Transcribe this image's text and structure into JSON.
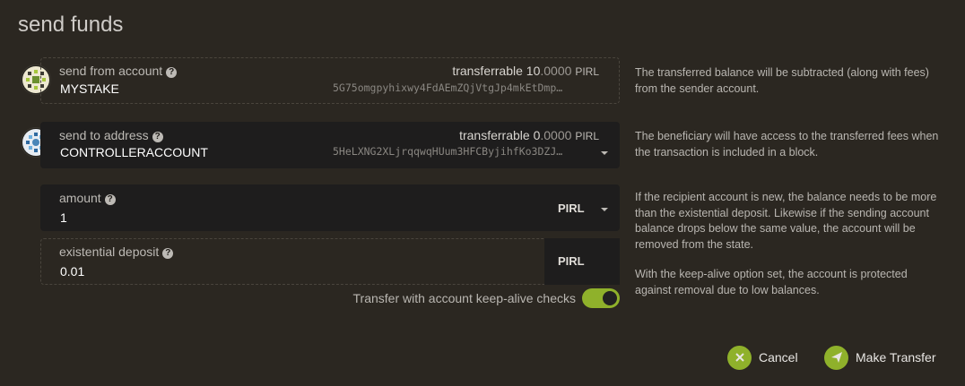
{
  "title": "send funds",
  "send_from": {
    "label": "send from account",
    "name": "MYSTAKE",
    "balance_label": "transferrable",
    "balance_int": "10",
    "balance_dec": ".0000",
    "balance_unit": "PIRL",
    "address": "5G75omgpyhixwy4FdAEmZQjVtgJp4mkEtDmp…",
    "help": "The transferred balance will be subtracted (along with fees) from the sender account."
  },
  "send_to": {
    "label": "send to address",
    "name": "CONTROLLERACCOUNT",
    "balance_label": "transferrable",
    "balance_int": "0",
    "balance_dec": ".0000",
    "balance_unit": "PIRL",
    "address": "5HeLXNG2XLjrqqwqHUum3HFCByjihfKo3DZJ…",
    "help": "The beneficiary will have access to the transferred fees when the transaction is included in a block."
  },
  "amount": {
    "label": "amount",
    "value": "1",
    "unit": "PIRL",
    "help": "If the recipient account is new, the balance needs to be more than the existential deposit. Likewise if the sending account balance drops below the same value, the account will be removed from the state."
  },
  "existential": {
    "label": "existential deposit",
    "value": "0.01",
    "unit": "PIRL"
  },
  "keepalive": {
    "label": "Transfer with account keep-alive checks",
    "help": "With the keep-alive option set, the account is protected against removal due to low balances."
  },
  "buttons": {
    "cancel": "Cancel",
    "transfer": "Make Transfer"
  },
  "colors": {
    "accent": "#8fb12b",
    "background": "#2b2721"
  }
}
